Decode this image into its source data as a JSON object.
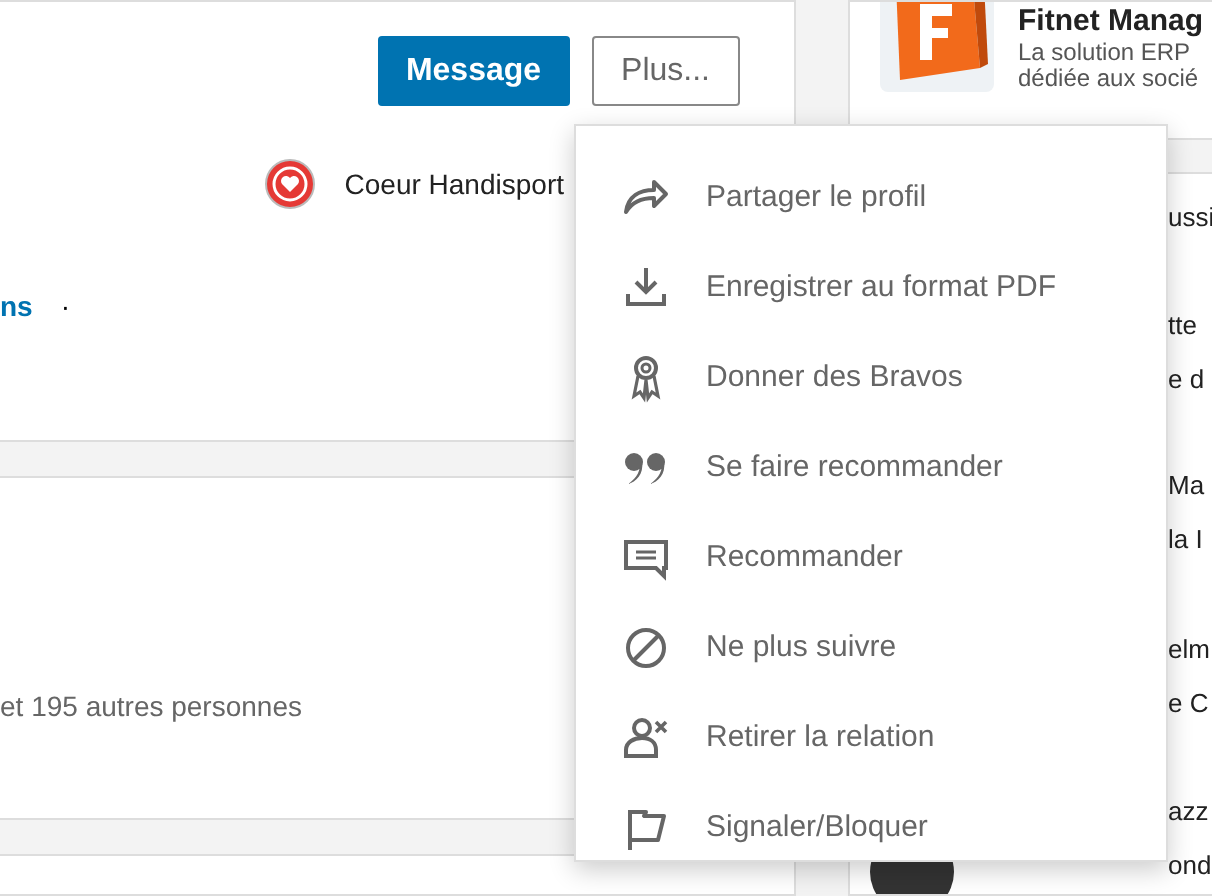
{
  "profile_card": {
    "buttons": [
      {
        "label": "Message",
        "kind": "primary"
      },
      {
        "label": "Plus...",
        "kind": "secondary"
      }
    ],
    "organization": "Coeur Handisport",
    "link_fragment": "ns",
    "separator": "·"
  },
  "activity_card": {
    "text": "et 195 autres personnes"
  },
  "ad_card": {
    "title": "Fitnet Manag",
    "lines": [
      "La solution ERP",
      "dédiée aux socié"
    ]
  },
  "people_list": {
    "fragments": [
      "ussi",
      "tte",
      "e d",
      "Ma",
      "la I",
      "elm",
      "e C",
      "azz",
      "ond"
    ]
  },
  "more_menu": {
    "items": [
      "Partager le profil",
      "Enregistrer au format PDF",
      "Donner des Bravos",
      "Se faire recommander",
      "Recommander",
      "Ne plus suivre",
      "Retirer la relation",
      "Signaler/Bloquer"
    ]
  }
}
